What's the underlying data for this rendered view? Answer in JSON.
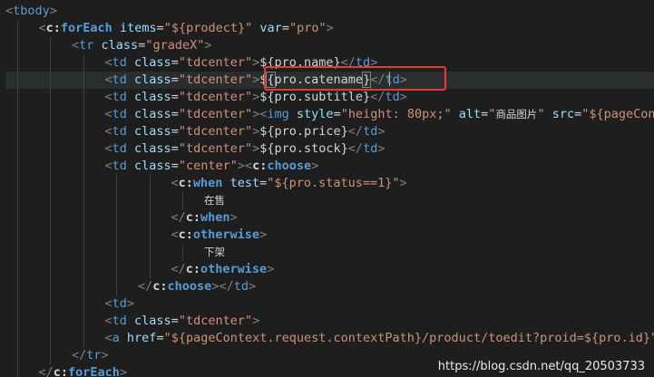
{
  "editor": {
    "current_line_index": 4,
    "lines": [
      {
        "indent": 0,
        "tokens": [
          [
            "punct",
            "<"
          ],
          [
            "tag",
            "tbody"
          ],
          [
            "punct",
            ">"
          ]
        ]
      },
      {
        "indent": 1,
        "tokens": [
          [
            "punct",
            "<"
          ],
          [
            "ns",
            "c:forEach"
          ],
          [
            "text",
            " "
          ],
          [
            "attr",
            "items"
          ],
          [
            "text",
            "="
          ],
          [
            "string",
            "\"${prodect}\""
          ],
          [
            "text",
            " "
          ],
          [
            "attr",
            "var"
          ],
          [
            "text",
            "="
          ],
          [
            "string",
            "\"pro\""
          ],
          [
            "punct",
            ">"
          ]
        ]
      },
      {
        "indent": 2,
        "tokens": [
          [
            "punct",
            "<"
          ],
          [
            "tag",
            "tr"
          ],
          [
            "text",
            " "
          ],
          [
            "attr",
            "class"
          ],
          [
            "text",
            "="
          ],
          [
            "string",
            "\"gradeX\""
          ],
          [
            "punct",
            ">"
          ]
        ]
      },
      {
        "indent": 3,
        "tokens": [
          [
            "punct",
            "<"
          ],
          [
            "tag",
            "td"
          ],
          [
            "text",
            " "
          ],
          [
            "attr",
            "class"
          ],
          [
            "text",
            "="
          ],
          [
            "string",
            "\"tdcenter\""
          ],
          [
            "punct",
            ">"
          ],
          [
            "text",
            "${pro.name}"
          ],
          [
            "punct",
            "</"
          ],
          [
            "tag",
            "td"
          ],
          [
            "punct",
            ">"
          ]
        ]
      },
      {
        "indent": 3,
        "tokens": [
          [
            "punct",
            "<"
          ],
          [
            "tag",
            "td"
          ],
          [
            "text",
            " "
          ],
          [
            "attr",
            "class"
          ],
          [
            "text",
            "="
          ],
          [
            "string",
            "\"tdcenter\""
          ],
          [
            "punct",
            ">"
          ],
          [
            "text",
            "$"
          ],
          [
            "bracket",
            "{"
          ],
          [
            "text",
            "pro.catename"
          ],
          [
            "bracket",
            "}"
          ],
          [
            "punct",
            "</"
          ],
          [
            "tag",
            "td"
          ],
          [
            "punct",
            ">"
          ]
        ]
      },
      {
        "indent": 3,
        "tokens": [
          [
            "punct",
            "<"
          ],
          [
            "tag",
            "td"
          ],
          [
            "text",
            " "
          ],
          [
            "attr",
            "class"
          ],
          [
            "text",
            "="
          ],
          [
            "string",
            "\"tdcenter\""
          ],
          [
            "punct",
            ">"
          ],
          [
            "text",
            "${pro.subtitle}"
          ],
          [
            "punct",
            "</"
          ],
          [
            "tag",
            "td"
          ],
          [
            "punct",
            ">"
          ]
        ]
      },
      {
        "indent": 3,
        "tokens": [
          [
            "punct",
            "<"
          ],
          [
            "tag",
            "td"
          ],
          [
            "text",
            " "
          ],
          [
            "attr",
            "class"
          ],
          [
            "text",
            "="
          ],
          [
            "string",
            "\"tdcenter\""
          ],
          [
            "punct",
            ">"
          ],
          [
            "punct",
            "<"
          ],
          [
            "tag",
            "img"
          ],
          [
            "text",
            " "
          ],
          [
            "attr",
            "style"
          ],
          [
            "text",
            "="
          ],
          [
            "string",
            "\"height: 80px;\""
          ],
          [
            "text",
            " "
          ],
          [
            "attr",
            "alt"
          ],
          [
            "text",
            "="
          ],
          [
            "string",
            "\""
          ],
          [
            "cjk",
            "商品图片"
          ],
          [
            "string",
            "\""
          ],
          [
            "text",
            " "
          ],
          [
            "attr",
            "src"
          ],
          [
            "text",
            "="
          ],
          [
            "string",
            "\"${pageContext.request.contextPath}"
          ]
        ]
      },
      {
        "indent": 3,
        "tokens": [
          [
            "punct",
            "<"
          ],
          [
            "tag",
            "td"
          ],
          [
            "text",
            " "
          ],
          [
            "attr",
            "class"
          ],
          [
            "text",
            "="
          ],
          [
            "string",
            "\"tdcenter\""
          ],
          [
            "punct",
            ">"
          ],
          [
            "text",
            "${pro.price}"
          ],
          [
            "punct",
            "</"
          ],
          [
            "tag",
            "td"
          ],
          [
            "punct",
            ">"
          ]
        ]
      },
      {
        "indent": 3,
        "tokens": [
          [
            "punct",
            "<"
          ],
          [
            "tag",
            "td"
          ],
          [
            "text",
            " "
          ],
          [
            "attr",
            "class"
          ],
          [
            "text",
            "="
          ],
          [
            "string",
            "\"tdcenter\""
          ],
          [
            "punct",
            ">"
          ],
          [
            "text",
            "${pro.stock}"
          ],
          [
            "punct",
            "</"
          ],
          [
            "tag",
            "td"
          ],
          [
            "punct",
            ">"
          ]
        ]
      },
      {
        "indent": 3,
        "tokens": [
          [
            "punct",
            "<"
          ],
          [
            "tag",
            "td"
          ],
          [
            "text",
            " "
          ],
          [
            "attr",
            "class"
          ],
          [
            "text",
            "="
          ],
          [
            "string",
            "\"center\""
          ],
          [
            "punct",
            ">"
          ],
          [
            "punct",
            "<"
          ],
          [
            "ns",
            "c:choose"
          ],
          [
            "punct",
            ">"
          ]
        ]
      },
      {
        "indent": 5,
        "tokens": [
          [
            "punct",
            "<"
          ],
          [
            "ns",
            "c:when"
          ],
          [
            "text",
            " "
          ],
          [
            "attr",
            "test"
          ],
          [
            "text",
            "="
          ],
          [
            "string",
            "\"${pro.status==1}\""
          ],
          [
            "punct",
            ">"
          ]
        ]
      },
      {
        "indent": 6,
        "tokens": [
          [
            "cjk",
            "在售"
          ]
        ]
      },
      {
        "indent": 5,
        "tokens": [
          [
            "punct",
            "</"
          ],
          [
            "ns",
            "c:when"
          ],
          [
            "punct",
            ">"
          ]
        ]
      },
      {
        "indent": 5,
        "tokens": [
          [
            "punct",
            "<"
          ],
          [
            "ns",
            "c:otherwise"
          ],
          [
            "punct",
            ">"
          ]
        ]
      },
      {
        "indent": 6,
        "tokens": [
          [
            "cjk",
            "下架"
          ]
        ]
      },
      {
        "indent": 5,
        "tokens": [
          [
            "punct",
            "</"
          ],
          [
            "ns",
            "c:otherwise"
          ],
          [
            "punct",
            ">"
          ]
        ]
      },
      {
        "indent": 4,
        "tokens": [
          [
            "punct",
            "</"
          ],
          [
            "ns",
            "c:choose"
          ],
          [
            "punct",
            ">"
          ],
          [
            "punct",
            "</"
          ],
          [
            "tag",
            "td"
          ],
          [
            "punct",
            ">"
          ]
        ]
      },
      {
        "indent": 3,
        "tokens": [
          [
            "punct",
            "<"
          ],
          [
            "tag",
            "td"
          ],
          [
            "punct",
            ">"
          ]
        ]
      },
      {
        "indent": 3,
        "tokens": [
          [
            "punct",
            "<"
          ],
          [
            "tag",
            "td"
          ],
          [
            "text",
            " "
          ],
          [
            "attr",
            "class"
          ],
          [
            "text",
            "="
          ],
          [
            "string",
            "\"tdcenter\""
          ],
          [
            "punct",
            ">"
          ]
        ]
      },
      {
        "indent": 3,
        "tokens": [
          [
            "punct",
            "<"
          ],
          [
            "tag",
            "a"
          ],
          [
            "text",
            " "
          ],
          [
            "attr",
            "href"
          ],
          [
            "text",
            "="
          ],
          [
            "string",
            "\"${pageContext.request.contextPath}/product/toedit?proid=${pro.id}\""
          ]
        ]
      },
      {
        "indent": 2,
        "tokens": [
          [
            "punct",
            "</"
          ],
          [
            "tag",
            "tr"
          ],
          [
            "punct",
            ">"
          ]
        ]
      },
      {
        "indent": 1,
        "tokens": [
          [
            "punct",
            "</"
          ],
          [
            "ns",
            "c:forEach"
          ],
          [
            "punct",
            ">"
          ]
        ]
      }
    ]
  },
  "watermark": "https://blog.csdn.net/qq_20503733",
  "colors": {
    "background": "#1e1e1e",
    "current_line": "#2a2d2e",
    "tag": "#569cd6",
    "attribute": "#9cdcfe",
    "string": "#ce9178",
    "text": "#d4d4d4",
    "punctuation": "#808080",
    "annotation_box": "#e53935"
  }
}
